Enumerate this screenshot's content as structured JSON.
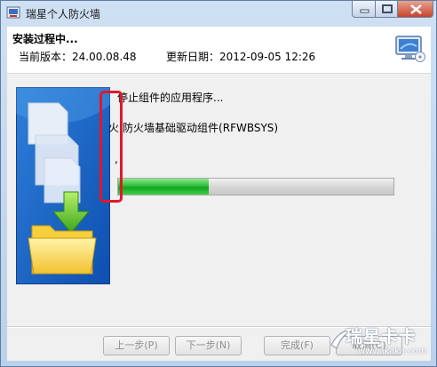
{
  "window": {
    "title": "瑞星个人防火墙"
  },
  "header": {
    "title": "安装过程中...",
    "version_text": "当前版本：24.00.08.48",
    "date_text": "更新日期：2012-09-05 12:26"
  },
  "status": {
    "line1": "停止组件的应用程序...",
    "line2": "火|防火墙基础驱动组件(RFWBSYS)",
    "line3": ","
  },
  "progress": {
    "percent": 33
  },
  "buttons": {
    "back": "上一步(P)",
    "next": "下一步(N)",
    "finish": "完成(F)",
    "cancel": "取消(C)"
  },
  "watermark": {
    "text": "瑞星卡卡",
    "url": "www.ikaka.com"
  },
  "colors": {
    "progress_fill": "#14a41e",
    "highlight": "#e2172b",
    "panel_border": "#1c3d86"
  }
}
